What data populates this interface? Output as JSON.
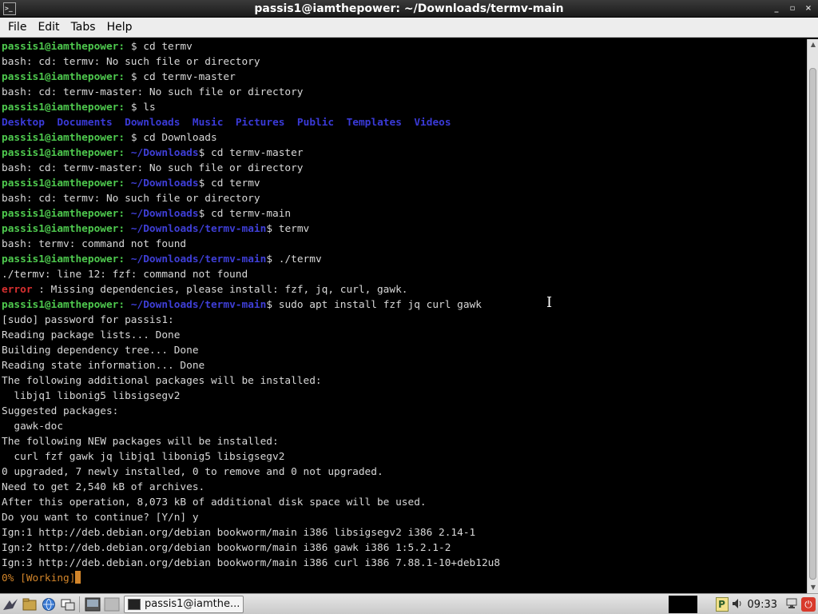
{
  "window": {
    "title": "passis1@iamthepower: ~/Downloads/termv-main",
    "controls": [
      "_",
      "▫",
      "×"
    ]
  },
  "menu": {
    "items": [
      "File",
      "Edit",
      "Tabs",
      "Help"
    ]
  },
  "terminal": {
    "prompt": "passis1@iamthepower",
    "lines": [
      {
        "type": "cmd",
        "path": "~",
        "cmd": "cd termv"
      },
      {
        "type": "out",
        "text": "bash: cd: termv: No such file or directory"
      },
      {
        "type": "cmd",
        "path": "~",
        "cmd": "cd termv-master"
      },
      {
        "type": "out",
        "text": "bash: cd: termv-master: No such file or directory"
      },
      {
        "type": "cmd",
        "path": "~",
        "cmd": "ls"
      },
      {
        "type": "dirs",
        "items": [
          "Desktop",
          "Documents",
          "Downloads",
          "Music",
          "Pictures",
          "Public",
          "Templates",
          "Videos"
        ]
      },
      {
        "type": "cmd",
        "path": "~",
        "cmd": "cd Downloads"
      },
      {
        "type": "cmd",
        "path": "~/Downloads",
        "cmd": "cd termv-master"
      },
      {
        "type": "out",
        "text": "bash: cd: termv-master: No such file or directory"
      },
      {
        "type": "cmd",
        "path": "~/Downloads",
        "cmd": "cd termv"
      },
      {
        "type": "out",
        "text": "bash: cd: termv: No such file or directory"
      },
      {
        "type": "cmd",
        "path": "~/Downloads",
        "cmd": "cd termv-main"
      },
      {
        "type": "cmd",
        "path": "~/Downloads/termv-main",
        "cmd": "termv"
      },
      {
        "type": "out",
        "text": "bash: termv: command not found"
      },
      {
        "type": "cmd",
        "path": "~/Downloads/termv-main",
        "cmd": "./termv"
      },
      {
        "type": "out",
        "text": "./termv: line 12: fzf: command not found"
      },
      {
        "type": "error",
        "label": "error",
        "text": " : Missing dependencies, please install: fzf, jq, curl, gawk."
      },
      {
        "type": "cmd",
        "path": "~/Downloads/termv-main",
        "cmd": "sudo apt install fzf jq curl gawk"
      },
      {
        "type": "out",
        "text": "[sudo] password for passis1:"
      },
      {
        "type": "out",
        "text": "Reading package lists... Done"
      },
      {
        "type": "out",
        "text": "Building dependency tree... Done"
      },
      {
        "type": "out",
        "text": "Reading state information... Done"
      },
      {
        "type": "out",
        "text": "The following additional packages will be installed:"
      },
      {
        "type": "out",
        "text": "  libjq1 libonig5 libsigsegv2"
      },
      {
        "type": "out",
        "text": "Suggested packages:"
      },
      {
        "type": "out",
        "text": "  gawk-doc"
      },
      {
        "type": "out",
        "text": "The following NEW packages will be installed:"
      },
      {
        "type": "out",
        "text": "  curl fzf gawk jq libjq1 libonig5 libsigsegv2"
      },
      {
        "type": "out",
        "text": "0 upgraded, 7 newly installed, 0 to remove and 0 not upgraded."
      },
      {
        "type": "out",
        "text": "Need to get 2,540 kB of archives."
      },
      {
        "type": "out",
        "text": "After this operation, 8,073 kB of additional disk space will be used."
      },
      {
        "type": "out",
        "text": "Do you want to continue? [Y/n] y"
      },
      {
        "type": "out",
        "text": "Ign:1 http://deb.debian.org/debian bookworm/main i386 libsigsegv2 i386 2.14-1"
      },
      {
        "type": "out",
        "text": "Ign:2 http://deb.debian.org/debian bookworm/main i386 gawk i386 1:5.2.1-2"
      },
      {
        "type": "out",
        "text": "Ign:3 http://deb.debian.org/debian bookworm/main i386 curl i386 7.88.1-10+deb12u8"
      },
      {
        "type": "progress",
        "text": "0% [Working]"
      }
    ]
  },
  "taskbar": {
    "task_label": "passis1@iamthe...",
    "clock": "09:33",
    "tray_badge": "P",
    "power_icon": "⏻"
  },
  "colors": {
    "prompt": "#4ec94e",
    "path": "#3f3fd8",
    "error": "#d83030",
    "progress": "#d2852a"
  }
}
